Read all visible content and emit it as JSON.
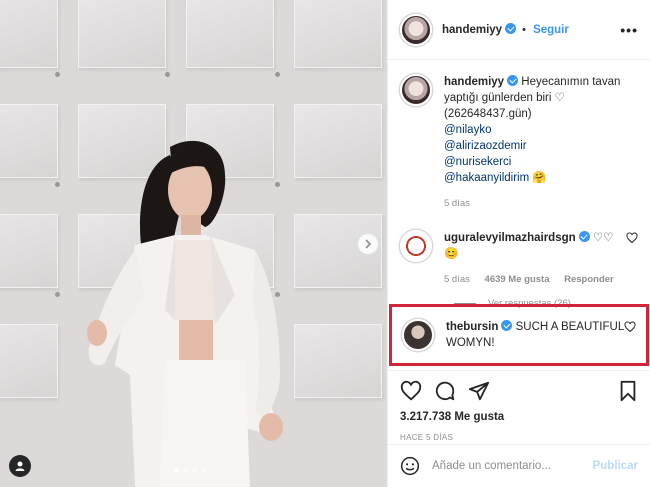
{
  "header": {
    "username": "handemiyy",
    "separator": "•",
    "follow_label": "Seguir",
    "more_label": "•••"
  },
  "caption": {
    "username": "handemiyy",
    "text": "Heyecanımın tavan yaptığı günlerden biri ♡ (262648437.gün)",
    "mentions": [
      "@nilayko",
      "@alirizaozdemir",
      "@nurisekerci",
      "@hakaanyildirim 🤗"
    ],
    "time": "5 días"
  },
  "comment1": {
    "username": "uguralevyilmazhairdsgn",
    "text": "♡♡",
    "emoji": "😊",
    "time": "5 días",
    "likes": "4639 Me gusta",
    "reply_label": "Responder",
    "view_replies": "Ver respuestas (26)"
  },
  "comment2": {
    "username": "thebursin",
    "text": "SUCH A BEAUTIFUL WOMYN!"
  },
  "post": {
    "likes": "3.217.738 Me gusta",
    "ago": "HACE 5 DÍAS"
  },
  "add_comment": {
    "placeholder": "Añade un comentario...",
    "publish_label": "Publicar"
  },
  "colors": {
    "accent": "#3897f0",
    "highlight": "#d2243a"
  }
}
